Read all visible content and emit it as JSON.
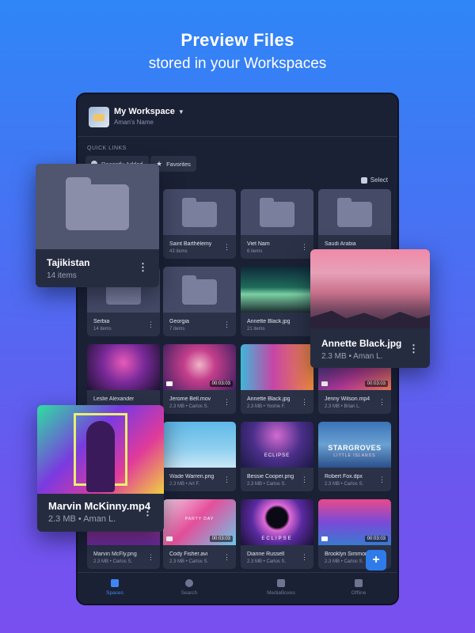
{
  "headline": {
    "title": "Preview Files",
    "subtitle": "stored in your Workspaces"
  },
  "workspace": {
    "title": "My Workspace",
    "subtitle": "Aman's Name"
  },
  "quick_links": {
    "label": "QUICK LINKS",
    "recent": "Recently Added",
    "favorites": "Favorites"
  },
  "select_label": "Select",
  "tiles": [
    {
      "name": "Saint Barthélemy",
      "meta": "43 items"
    },
    {
      "name": "Viet Nam",
      "meta": "6 items"
    },
    {
      "name": "Saudi Arabia",
      "meta": ""
    },
    {
      "name": "Serbia",
      "meta": "14 items"
    },
    {
      "name": "Georgia",
      "meta": "7 items"
    },
    {
      "name": "Annette Black.jpg",
      "meta": "21 items"
    },
    {
      "name": "Leslie Alexander",
      "meta": ""
    },
    {
      "name": "Jerome Bell.mov",
      "meta": "2.3 MB • Carlos S.",
      "duration": "00:03:03"
    },
    {
      "name": "Annette Black.jpg",
      "meta": "2.3 MB • Yoshie F."
    },
    {
      "name": "Jenny Wilson.mp4",
      "meta": "2.3 MB • Brian L.",
      "duration": "00:03:03"
    },
    {
      "name": "Wade Warren.png",
      "meta": "2.3 MB • Art F."
    },
    {
      "name": "Bessie Cooper.png",
      "meta": "2.3 MB • Carlos S."
    },
    {
      "name": "Robert Fox.dpx",
      "meta": "2.3 MB • Carlos S."
    },
    {
      "name": "Marvin McFly.png",
      "meta": "2.3 MB • Carlos S."
    },
    {
      "name": "Cody Fisher.avi",
      "meta": "2.3 MB • Carlos S.",
      "duration": "00:03:03"
    },
    {
      "name": "Dianne Russell",
      "meta": "2.3 MB • Carlos S."
    },
    {
      "name": "Brooklyn Simmons",
      "meta": "2.3 MB • Carlos S.",
      "duration": "00:03:03"
    }
  ],
  "thumb_text": {
    "stargroves": "STARGROVES",
    "little_islands": "LITTLE ISLANDS",
    "eclipse": "ECLIPSE",
    "eclipse2": "ECLIPSE",
    "party_day": "PARTY DAY"
  },
  "fab_label": "+",
  "tabs": {
    "spaces": "Spaces",
    "search": "Search",
    "mediaboxes": "MediaBoxes",
    "offline": "Offline"
  },
  "cards": {
    "tajikistan": {
      "name": "Tajikistan",
      "meta": "14 items"
    },
    "annette": {
      "name": "Annette Black.jpg",
      "meta": "2.3 MB • Aman L."
    },
    "marvin": {
      "name": "Marvin McKinny.mp4",
      "meta": "2.3 MB • Aman L."
    }
  },
  "colors": {
    "background_top": "#2f86f7",
    "background_bottom": "#7a4ff0",
    "device": "#1b2135",
    "accent": "#3f86f5"
  }
}
